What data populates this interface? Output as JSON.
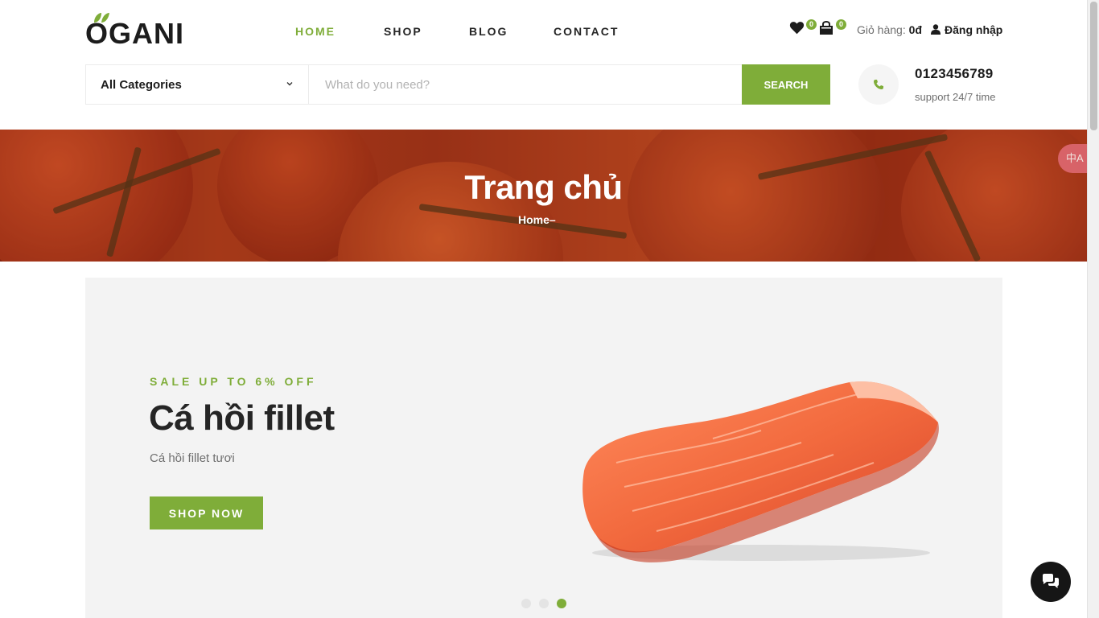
{
  "header": {
    "logo_text": "OGANI",
    "nav": [
      {
        "label": "HOME",
        "active": true
      },
      {
        "label": "SHOP",
        "active": false
      },
      {
        "label": "BLOG",
        "active": false
      },
      {
        "label": "CONTACT",
        "active": false
      }
    ],
    "wishlist_count": "0",
    "cart_count": "0",
    "cart_total_label": "Giỏ hàng:",
    "cart_total_value": "0đ",
    "login_label": "Đăng nhập"
  },
  "search": {
    "category_label": "All Categories",
    "placeholder": "What do you need?",
    "button_label": "SEARCH"
  },
  "contact": {
    "phone": "0123456789",
    "support": "support 24/7 time"
  },
  "breadcrumb": {
    "title": "Trang chủ",
    "crumb": "Home",
    "separator": "–"
  },
  "hero": {
    "tag": "SALE UP TO 6% OFF",
    "title": "Cá hồi fillet",
    "description": "Cá hồi fillet tươi",
    "button_label": "SHOP NOW",
    "slides": 3,
    "active_slide": 3
  },
  "floating": {
    "translate_label": "中A"
  },
  "colors": {
    "accent": "#7fad39",
    "text_dark": "#1c1c1c",
    "muted": "#6f6f6f",
    "hero_bg": "#f3f3f3",
    "banner": "#a3361a"
  }
}
